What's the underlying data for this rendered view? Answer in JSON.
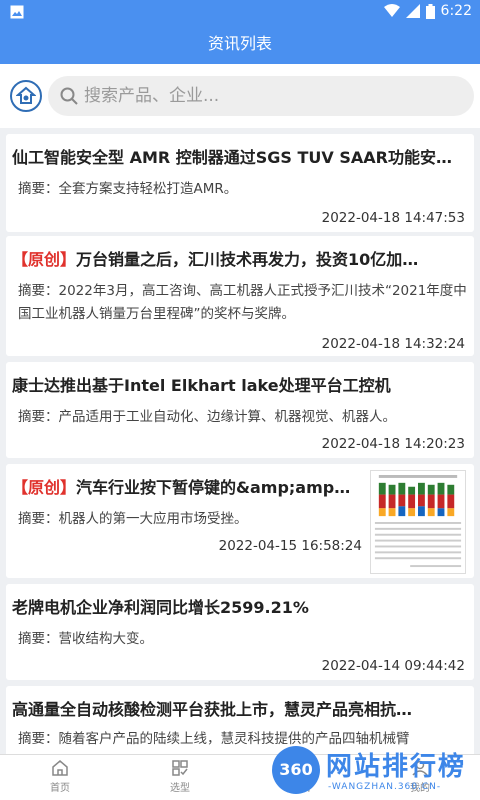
{
  "status_bar": {
    "time": "6:22"
  },
  "header": {
    "title": "资讯列表"
  },
  "search": {
    "placeholder": "搜索产品、企业..."
  },
  "articles": [
    {
      "tag": "",
      "title": "仙工智能安全型 AMR 控制器通过SGS TUV SAAR功能安…",
      "summary": "摘要：全套方案支持轻松打造AMR。",
      "date": "2022-04-18 14:47:53"
    },
    {
      "tag": "【原创】",
      "title": "万台销量之后，汇川技术再发力，投资10亿加…",
      "summary": "摘要：2022年3月，高工咨询、高工机器人正式授予汇川技术“2021年度中国工业机器人销量万台里程碑”的奖杯与奖牌。",
      "date": "2022-04-18 14:32:24"
    },
    {
      "tag": "",
      "title": "康士达推出基于Intel Elkhart lake处理平台工控机",
      "summary": "摘要：产品适用于工业自动化、边缘计算、机器视觉、机器人。",
      "date": "2022-04-18 14:20:23"
    },
    {
      "tag": "【原创】",
      "title": "汽车行业按下暂停键的&amp;amp…",
      "summary": "摘要：机器人的第一大应用市场受挫。",
      "date": "2022-04-15 16:58:24"
    },
    {
      "tag": "",
      "title": "老牌电机企业净利润同比增长2599.21%",
      "summary": "摘要：营收结构大变。",
      "date": "2022-04-14 09:44:42"
    },
    {
      "tag": "",
      "title": "高通量全自动核酸检测平台获批上市，慧灵产品亮相抗…",
      "summary": "摘要：随着客户产品的陆续上线，慧灵科技提供的产品四轴机械臂",
      "date": ""
    }
  ],
  "bottom_nav": [
    {
      "label": "首页",
      "icon": "home-icon"
    },
    {
      "label": "选型",
      "icon": "select-icon"
    },
    {
      "label": "资讯",
      "icon": "news-icon"
    },
    {
      "label": "我的",
      "icon": "profile-icon"
    }
  ],
  "watermark": {
    "badge": "360",
    "text": "网站排行榜",
    "sub": "-WANGZHAN.360.CN-"
  },
  "colors": {
    "primary": "#4a90f0",
    "tag_red": "#e0322d"
  }
}
